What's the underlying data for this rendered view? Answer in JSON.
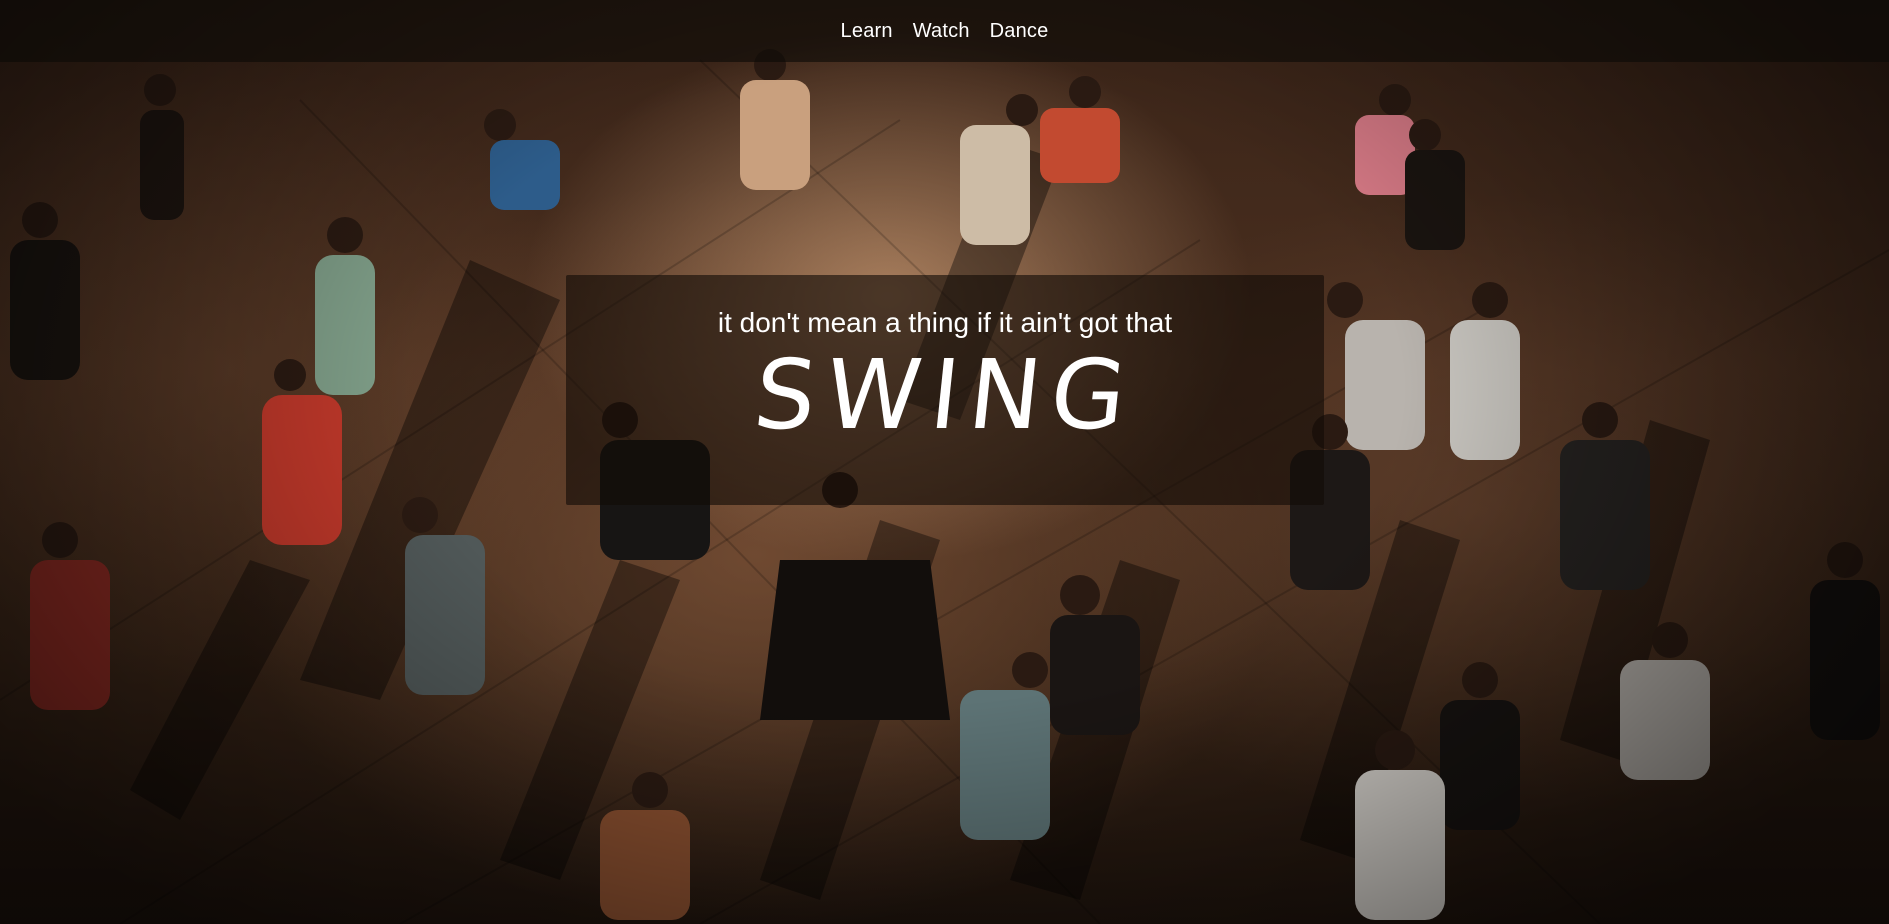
{
  "nav": {
    "items": [
      {
        "label": "Learn"
      },
      {
        "label": "Watch"
      },
      {
        "label": "Dance"
      }
    ]
  },
  "hero": {
    "tagline": "it don't mean a thing if it ain't got that",
    "headline": "SWING",
    "background_image": "dancers-on-plaza-night-photo"
  },
  "colors": {
    "text": "#ffffff",
    "overlay": "#120b07",
    "photo_warm": "#c49670"
  }
}
